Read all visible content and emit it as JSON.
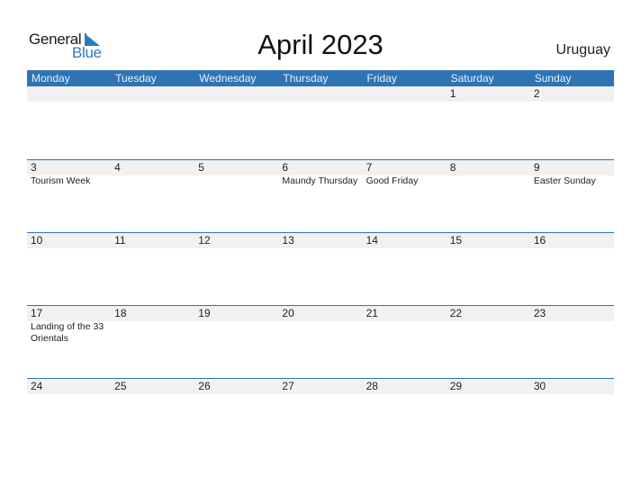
{
  "logo": {
    "word1": "General",
    "word2": "Blue"
  },
  "title": "April 2023",
  "country": "Uruguay",
  "colors": {
    "accent": "#2e74b5",
    "band": "#f1f1f1",
    "logo_blue": "#2a7bc0"
  },
  "weekdays": [
    "Monday",
    "Tuesday",
    "Wednesday",
    "Thursday",
    "Friday",
    "Saturday",
    "Sunday"
  ],
  "weeks": [
    {
      "days": [
        {
          "num": "",
          "event": ""
        },
        {
          "num": "",
          "event": ""
        },
        {
          "num": "",
          "event": ""
        },
        {
          "num": "",
          "event": ""
        },
        {
          "num": "",
          "event": ""
        },
        {
          "num": "1",
          "event": ""
        },
        {
          "num": "2",
          "event": ""
        }
      ]
    },
    {
      "days": [
        {
          "num": "3",
          "event": "Tourism Week"
        },
        {
          "num": "4",
          "event": ""
        },
        {
          "num": "5",
          "event": ""
        },
        {
          "num": "6",
          "event": "Maundy Thursday"
        },
        {
          "num": "7",
          "event": "Good Friday"
        },
        {
          "num": "8",
          "event": ""
        },
        {
          "num": "9",
          "event": "Easter Sunday"
        }
      ]
    },
    {
      "days": [
        {
          "num": "10",
          "event": ""
        },
        {
          "num": "11",
          "event": ""
        },
        {
          "num": "12",
          "event": ""
        },
        {
          "num": "13",
          "event": ""
        },
        {
          "num": "14",
          "event": ""
        },
        {
          "num": "15",
          "event": ""
        },
        {
          "num": "16",
          "event": ""
        }
      ]
    },
    {
      "days": [
        {
          "num": "17",
          "event": "Landing of the 33 Orientals"
        },
        {
          "num": "18",
          "event": ""
        },
        {
          "num": "19",
          "event": ""
        },
        {
          "num": "20",
          "event": ""
        },
        {
          "num": "21",
          "event": ""
        },
        {
          "num": "22",
          "event": ""
        },
        {
          "num": "23",
          "event": ""
        }
      ]
    },
    {
      "days": [
        {
          "num": "24",
          "event": ""
        },
        {
          "num": "25",
          "event": ""
        },
        {
          "num": "26",
          "event": ""
        },
        {
          "num": "27",
          "event": ""
        },
        {
          "num": "28",
          "event": ""
        },
        {
          "num": "29",
          "event": ""
        },
        {
          "num": "30",
          "event": ""
        }
      ]
    }
  ]
}
